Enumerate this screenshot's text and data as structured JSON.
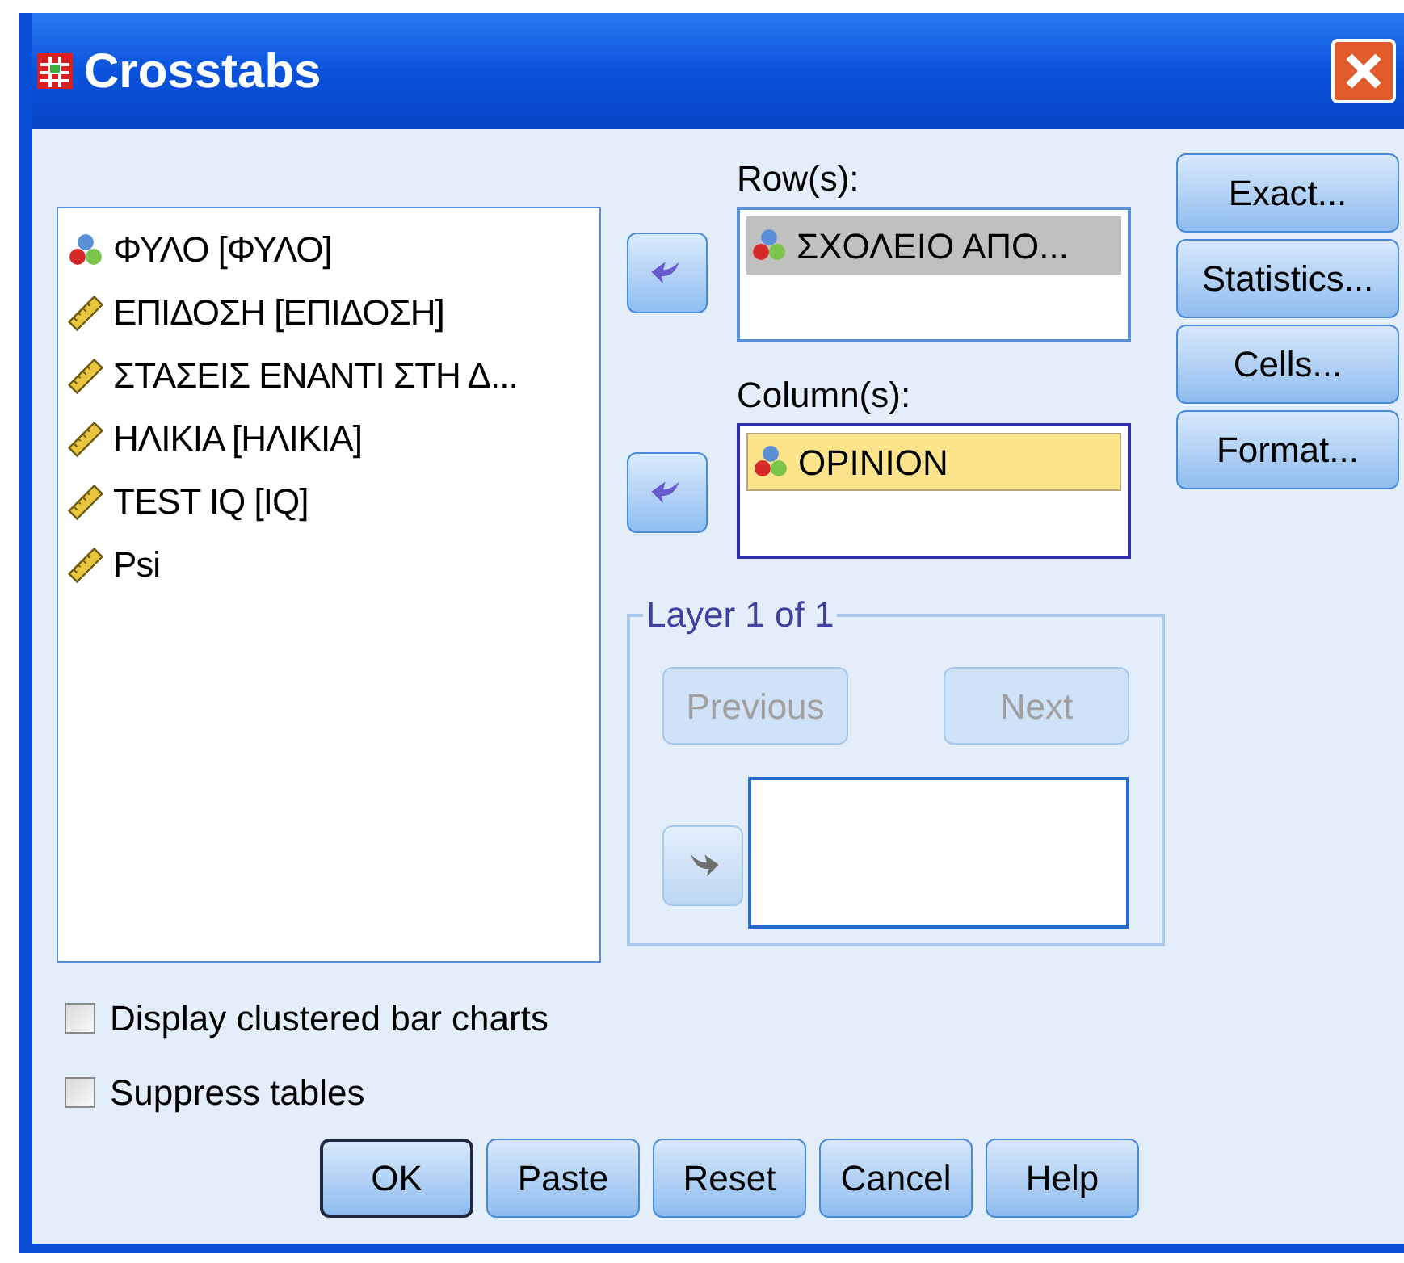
{
  "window": {
    "title": "Crosstabs"
  },
  "variables": [
    {
      "name": "ΦΥΛΟ [ΦΥΛΟ]",
      "kind": "nominal"
    },
    {
      "name": "ΕΠΙΔΟΣΗ [ΕΠΙΔΟΣΗ]",
      "kind": "scale"
    },
    {
      "name": "ΣΤΑΣΕΙΣ ΕΝΑΝΤΙ ΣΤΗ Δ...",
      "kind": "scale"
    },
    {
      "name": "ΗΛΙΚΙΑ [ΗΛΙΚΙΑ]",
      "kind": "scale"
    },
    {
      "name": "TEST IQ [IQ]",
      "kind": "scale"
    },
    {
      "name": "Psi",
      "kind": "scale"
    }
  ],
  "rows": {
    "label": "Row(s):",
    "move_button": {
      "kind": "left",
      "disabled": false
    },
    "focused": false,
    "items": [
      {
        "name": "ΣΧΟΛΕΙΟ ΑΠΟ...",
        "kind": "nominal",
        "selected": true
      }
    ]
  },
  "columns": {
    "label": "Column(s):",
    "move_button": {
      "kind": "left",
      "disabled": false
    },
    "focused": true,
    "items": [
      {
        "name": "OPINION",
        "kind": "nominal",
        "selected": true
      }
    ]
  },
  "layer": {
    "title": "Layer 1 of 1",
    "buttons": [
      {
        "label": "Previous",
        "disabled": true
      },
      {
        "label": "Next",
        "disabled": true
      }
    ],
    "move_button": {
      "kind": "right",
      "disabled": true
    }
  },
  "side_buttons": [
    {
      "label": "Exact..."
    },
    {
      "label": "Statistics..."
    },
    {
      "label": "Cells..."
    },
    {
      "label": "Format..."
    }
  ],
  "options": [
    {
      "label": "Display clustered bar charts",
      "checked": false
    },
    {
      "label": "Suppress tables",
      "checked": false
    }
  ],
  "buttons": [
    {
      "label": "OK",
      "default": true
    },
    {
      "label": "Paste",
      "default": false
    },
    {
      "label": "Reset",
      "default": false
    },
    {
      "label": "Cancel",
      "default": false
    },
    {
      "label": "Help",
      "default": false
    }
  ]
}
